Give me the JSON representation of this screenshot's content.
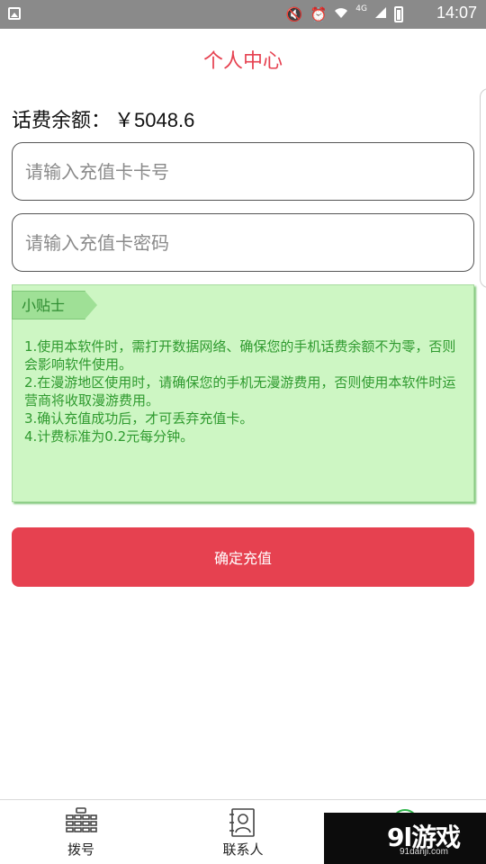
{
  "status_bar": {
    "time": "14:07",
    "network": "4G"
  },
  "header": {
    "title": "个人中心"
  },
  "balance": {
    "label": "话费余额：",
    "amount": "￥5048.6"
  },
  "form": {
    "card_number_placeholder": "请输入充值卡卡号",
    "card_password_placeholder": "请输入充值卡密码"
  },
  "tips": {
    "tag": "小贴士",
    "lines": [
      "1.使用本软件时，需打开数据网络、确保您的手机话费余额不为零，否则会影响软件使用。",
      "2.在漫游地区使用时，请确保您的手机无漫游费用，否则使用本软件时运营商将收取漫游费用。",
      "3.确认充值成功后，才可丢弃充值卡。",
      "4.计费标准为0.2元每分钟。"
    ]
  },
  "confirm_button": {
    "label": "确定充值"
  },
  "bottom_nav": {
    "items": [
      {
        "label": "拨号",
        "icon": "dialpad-icon"
      },
      {
        "label": "联系人",
        "icon": "contacts-icon"
      },
      {
        "label": "",
        "icon": "profile-icon"
      }
    ]
  },
  "watermark": {
    "logo": "9l游戏",
    "url": "91danji.com"
  },
  "colors": {
    "accent": "#e64150",
    "tips_background": "#cdf6c3",
    "tips_text": "#2f9a2f",
    "status_bar": "#8a8a8a"
  }
}
